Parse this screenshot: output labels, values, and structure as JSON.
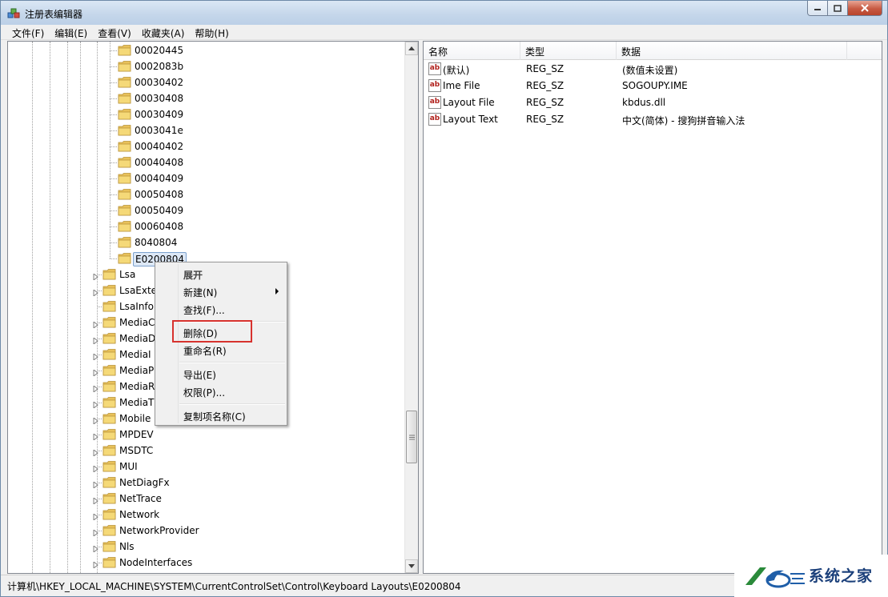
{
  "window": {
    "title": "注册表编辑器"
  },
  "menubar": [
    "文件(F)",
    "编辑(E)",
    "查看(V)",
    "收藏夹(A)",
    "帮助(H)"
  ],
  "tree": {
    "subkeys": [
      "00020445",
      "0002083b",
      "00030402",
      "00030408",
      "00030409",
      "0003041e",
      "00040402",
      "00040408",
      "00040409",
      "00050408",
      "00050409",
      "00060408",
      "8040804"
    ],
    "selected": "E0200804",
    "siblings": [
      "Lsa",
      "LsaExte",
      "LsaInfo",
      "MediaC",
      "MediaD",
      "MediaI",
      "MediaP",
      "MediaR",
      "MediaT",
      "Mobile",
      "MPDEV",
      "MSDTC",
      "MUI",
      "NetDiagFx",
      "NetTrace",
      "Network",
      "NetworkProvider",
      "Nls",
      "NodeInterfaces"
    ]
  },
  "list": {
    "headers": [
      "名称",
      "类型",
      "数据"
    ],
    "rows": [
      {
        "name": "(默认)",
        "type": "REG_SZ",
        "data": "(数值未设置)"
      },
      {
        "name": "Ime File",
        "type": "REG_SZ",
        "data": "SOGOUPY.IME"
      },
      {
        "name": "Layout File",
        "type": "REG_SZ",
        "data": "kbdus.dll"
      },
      {
        "name": "Layout Text",
        "type": "REG_SZ",
        "data": "中文(简体) - 搜狗拼音输入法"
      }
    ]
  },
  "context_menu": {
    "expand": "展开",
    "new": "新建(N)",
    "find": "查找(F)...",
    "delete": "删除(D)",
    "rename": "重命名(R)",
    "export": "导出(E)",
    "permissions": "权限(P)...",
    "copy_key_name": "复制项名称(C)"
  },
  "statusbar": {
    "path": "计算机\\HKEY_LOCAL_MACHINE\\SYSTEM\\CurrentControlSet\\Control\\Keyboard Layouts\\E0200804"
  },
  "watermark": {
    "text": "系统之家"
  },
  "colors": {
    "highlight_border": "#d7322e",
    "folder": "#e8c15a",
    "selection": "#dde8f6"
  }
}
